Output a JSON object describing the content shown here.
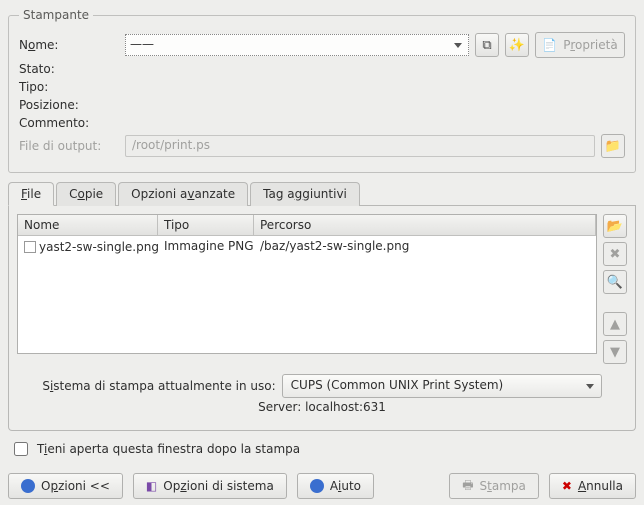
{
  "printer": {
    "groupTitle": "Stampante",
    "nameLabelPre": "N",
    "nameLabelU": "o",
    "nameLabelPost": "me:",
    "stateLabel": "Stato:",
    "typeLabel": "Tipo:",
    "positionLabel": "Posizione:",
    "commentLabel": "Commento:",
    "outputLabel": "File di output:",
    "outputValue": "/root/print.ps",
    "selectedPrinter": "——",
    "propsPre": "P",
    "propsU": "r",
    "propsPost": "oprietà"
  },
  "tabs": {
    "fileU": "F",
    "filePost": "ile",
    "copiesPre": "C",
    "copiesU": "o",
    "copiesPost": "pie",
    "advPre": "Opzioni a",
    "advU": "v",
    "advPost": "anzate",
    "tagsPre": "Tag a",
    "tagsU": "g",
    "tagsPost": "giuntivi"
  },
  "listHeaders": {
    "name": "Nome",
    "type": "Tipo",
    "path": "Percorso"
  },
  "files": {
    "row0": {
      "name": "yast2-sw-single.png",
      "type": "Immagine PNG",
      "path": "/baz/yast2-sw-single.png"
    }
  },
  "system": {
    "labelPre": "S",
    "labelU": "i",
    "labelPost": "stema di stampa attualmente in uso:",
    "value": "CUPS (Common UNIX Print Sy_stem)",
    "serverLabel": "Server:",
    "serverValue": "localhost:631"
  },
  "keepOpen": {
    "pre": "T",
    "u": "i",
    "post": "eni aperta questa finestra dopo la stampa"
  },
  "buttons": {
    "optionsPre": "O",
    "optionsU": "p",
    "optionsPost": "zioni <<",
    "sysOptPre": "Op",
    "sysOptU": "z",
    "sysOptPost": "ioni di sistema",
    "helpPre": "A",
    "helpU": "i",
    "helpPost": "uto",
    "printPre": "S",
    "printU": "t",
    "printPost": "ampa",
    "cancelU": "A",
    "cancelPost": "nnulla"
  }
}
